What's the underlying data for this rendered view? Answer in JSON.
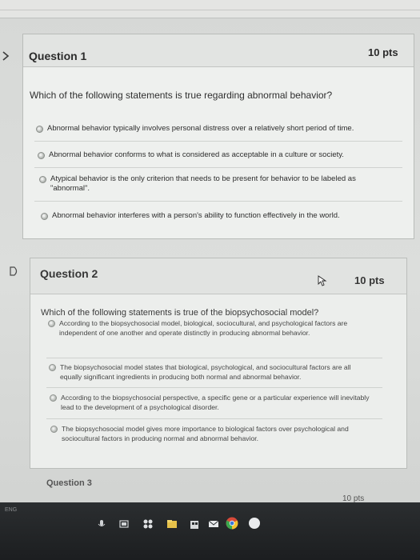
{
  "question1": {
    "title": "Question 1",
    "points": "10 pts",
    "prompt": "Which of the following statements is true regarding abnormal behavior?",
    "answers": [
      "Abnormal behavior typically involves personal distress over a relatively short period of time.",
      "Abnormal behavior conforms to what is considered as acceptable in a culture or society.",
      "Atypical behavior is the only criterion that needs to be present for behavior to be labeled as \"abnormal\".",
      "Abnormal behavior interferes with a person's ability to function effectively in the world."
    ]
  },
  "question2": {
    "title": "Question 2",
    "points": "10 pts",
    "prompt": "Which of the following statements is true of the biopsychosocial model?",
    "answers": [
      "According to the biopsychosocial model, biological, sociocultural, and psychological factors are independent of one another and operate distinctly in producing abnormal behavior.",
      "The biopsychosocial model states that biological, psychological, and sociocultural factors are all equally significant ingredients in producing both normal and abnormal behavior.",
      "According to the biopsychosocial perspective, a specific gene or a particular experience will inevitably lead to the development of a psychological disorder.",
      "The biopsychosocial model gives more importance to biological factors over psychological and sociocultural factors in producing normal and abnormal behavior."
    ]
  },
  "question3_peek": {
    "title": "Question 3",
    "points": "10 pts"
  },
  "taskbar": {
    "lang": "ENG"
  },
  "icons": {
    "flag": "flag-icon",
    "cursor": "mouse-cursor-icon",
    "file_explorer": "file-explorer-icon",
    "store": "store-icon",
    "mail": "mail-icon",
    "chrome": "chrome-icon"
  }
}
